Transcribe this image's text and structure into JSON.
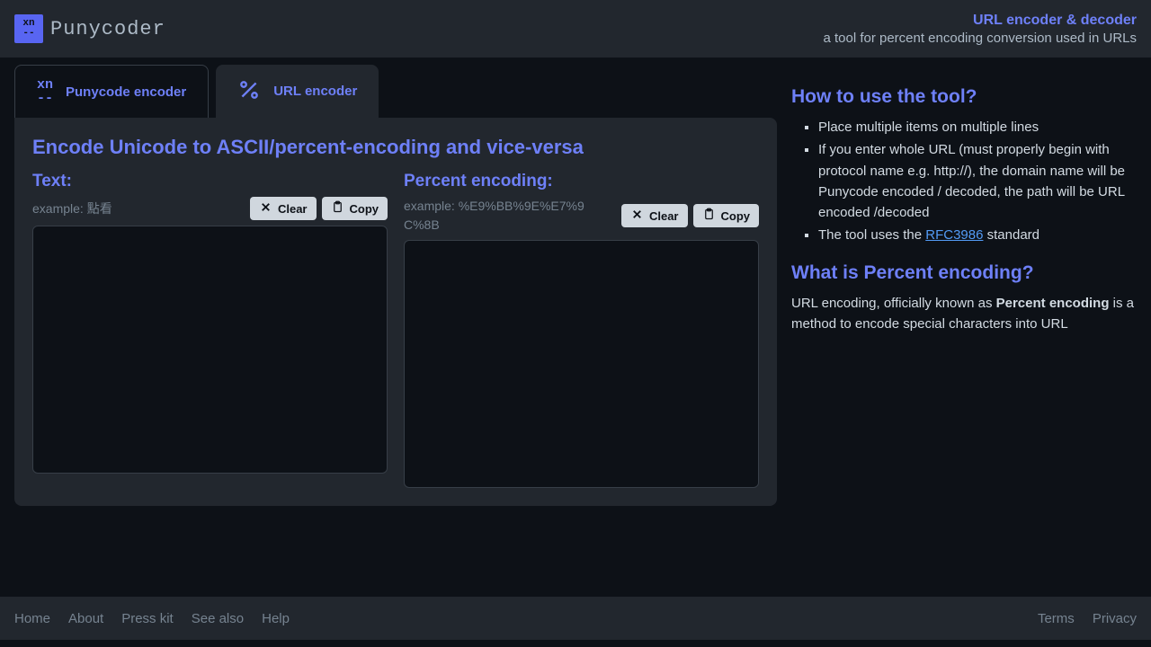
{
  "header": {
    "logo_top": "xn",
    "logo_bottom": "--",
    "brand": "Punycoder",
    "title": "URL encoder & decoder",
    "subtitle": "a tool for percent encoding conversion used in URLs"
  },
  "tabs": {
    "punycode": "Punycode encoder",
    "url": "URL encoder"
  },
  "panel": {
    "title": "Encode Unicode to ASCII/percent-encoding and vice-versa",
    "left": {
      "label": "Text:",
      "example": "example: 點看",
      "clear": "Clear",
      "copy": "Copy",
      "value": ""
    },
    "right": {
      "label": "Percent encoding:",
      "example": "example: %E9%BB%9E%E7%9C%8B",
      "clear": "Clear",
      "copy": "Copy",
      "value": ""
    }
  },
  "help": {
    "how_title": "How to use the tool?",
    "how_items": [
      "Place multiple items on multiple lines",
      "If you enter whole URL (must properly begin with protocol name e.g. http://), the domain name will be Punycode encoded / decoded, the path will be URL encoded /decoded",
      "The tool uses the RFC3986 standard"
    ],
    "rfc_link_text": "RFC3986",
    "what_title": "What is Percent encoding?",
    "what_body_prefix": "URL encoding, officially known as ",
    "what_body_strong": "Percent encoding",
    "what_body_suffix": " is a method to encode special characters into URL"
  },
  "footer": {
    "left": [
      "Home",
      "About",
      "Press kit",
      "See also",
      "Help"
    ],
    "right": [
      "Terms",
      "Privacy"
    ]
  }
}
